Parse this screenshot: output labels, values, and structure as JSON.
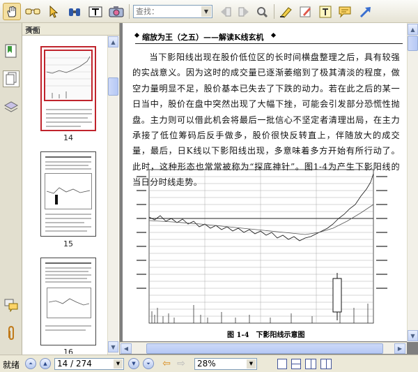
{
  "toolbar": {
    "find_placeholder": "查找：",
    "buttons": [
      "hand-tool",
      "select-text-glasses",
      "select-arrow",
      "binoculars",
      "text-select",
      "snapshot-camera",
      "prev-result",
      "next-result",
      "search-zoom",
      "highlight",
      "note-pad",
      "text-box",
      "comment",
      "arrow-tool"
    ]
  },
  "panel": {
    "title": "页面",
    "thumbnails": [
      {
        "label": "14",
        "selected": true
      },
      {
        "label": "15",
        "selected": false
      },
      {
        "label": "16",
        "selected": false
      }
    ]
  },
  "document": {
    "header": "缩放为王（之五）——解读K线玄机",
    "paragraph": "当下影阳线出现在股价低位区的长时间横盘整理之后，具有较强的实战意义。因为这时的成交量已逐渐萎缩到了极其清淡的程度，做空力量明显不足，股价基本已失去了下跌的动力。若在此之后的某一日当中，股价在盘中突然出现了大幅下挫，可能会引发部分恐慌性抛盘。主力则可以借此机会将最后一批信心不坚定者清理出局，在主力承接了低位筹码后反手做多，股价很快反转直上，伴随放大的成交量，最后，日K线以下影阳线出现，多意味着多方开始有所行动了。此时，这种形态也常常被称为“探底神针”。图1-4为产生下影阳线的当日分时线走势。",
    "figure_caption": "图 1-4　下影阳线示意图"
  },
  "status": {
    "ready": "就绪",
    "page_value": "14 / 274",
    "zoom_value": "28%"
  },
  "colors": {
    "accent_selected": "#c0242c",
    "doc_background": "#7f7f7f",
    "chrome": "#ece9d8"
  }
}
